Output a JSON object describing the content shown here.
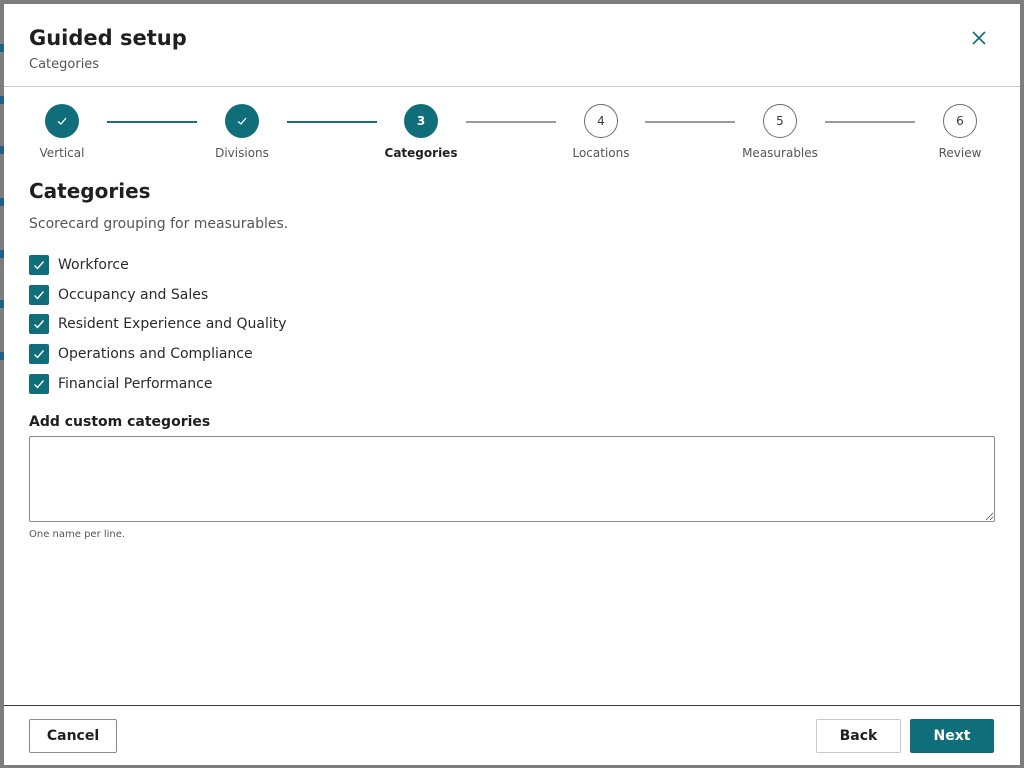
{
  "dialog": {
    "title": "Guided setup",
    "subtitle": "Categories",
    "close_icon": "close-icon"
  },
  "stepper": {
    "steps": [
      {
        "label": "Vertical",
        "number": "1",
        "state": "done"
      },
      {
        "label": "Divisions",
        "number": "2",
        "state": "done"
      },
      {
        "label": "Categories",
        "number": "3",
        "state": "current"
      },
      {
        "label": "Locations",
        "number": "4",
        "state": "todo"
      },
      {
        "label": "Measurables",
        "number": "5",
        "state": "todo"
      },
      {
        "label": "Review",
        "number": "6",
        "state": "todo"
      }
    ]
  },
  "content": {
    "heading": "Categories",
    "description": "Scorecard grouping for measurables.",
    "categories": [
      {
        "label": "Workforce",
        "checked": true
      },
      {
        "label": "Occupancy and Sales",
        "checked": true
      },
      {
        "label": "Resident Experience and Quality",
        "checked": true
      },
      {
        "label": "Operations and Compliance",
        "checked": true
      },
      {
        "label": "Financial Performance",
        "checked": true
      }
    ],
    "custom_label": "Add custom categories",
    "custom_value": "",
    "custom_hint": "One name per line."
  },
  "footer": {
    "cancel_label": "Cancel",
    "back_label": "Back",
    "next_label": "Next"
  },
  "colors": {
    "accent": "#0f6e79",
    "connector_done": "#1d6f7b",
    "connector_todo": "#9a9a9a"
  }
}
